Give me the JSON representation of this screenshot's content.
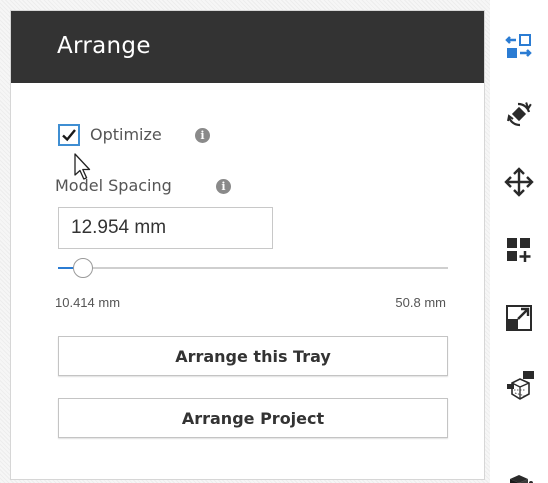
{
  "panel": {
    "title": "Arrange",
    "optimize": {
      "label": "Optimize",
      "checked": true,
      "info_icon": "info-icon"
    },
    "model_spacing": {
      "label": "Model Spacing",
      "info_icon": "info-icon",
      "value": "12.954 mm",
      "slider_min": "10.414 mm",
      "slider_max": "50.8 mm",
      "slider_fraction": 0.063
    },
    "buttons": {
      "arrange_tray": "Arrange this Tray",
      "arrange_project": "Arrange Project"
    }
  },
  "toolbar": {
    "tools": [
      {
        "icon": "arrange-icon"
      },
      {
        "icon": "rotate-icon"
      },
      {
        "icon": "move-icon"
      },
      {
        "icon": "duplicate-icon"
      },
      {
        "icon": "scale-icon"
      },
      {
        "icon": "support-icon"
      },
      {
        "icon": "model-icon"
      }
    ]
  },
  "colors": {
    "accent": "#2b7cd3",
    "header_bg": "#333333",
    "icon_dark": "#2a2a2a"
  }
}
